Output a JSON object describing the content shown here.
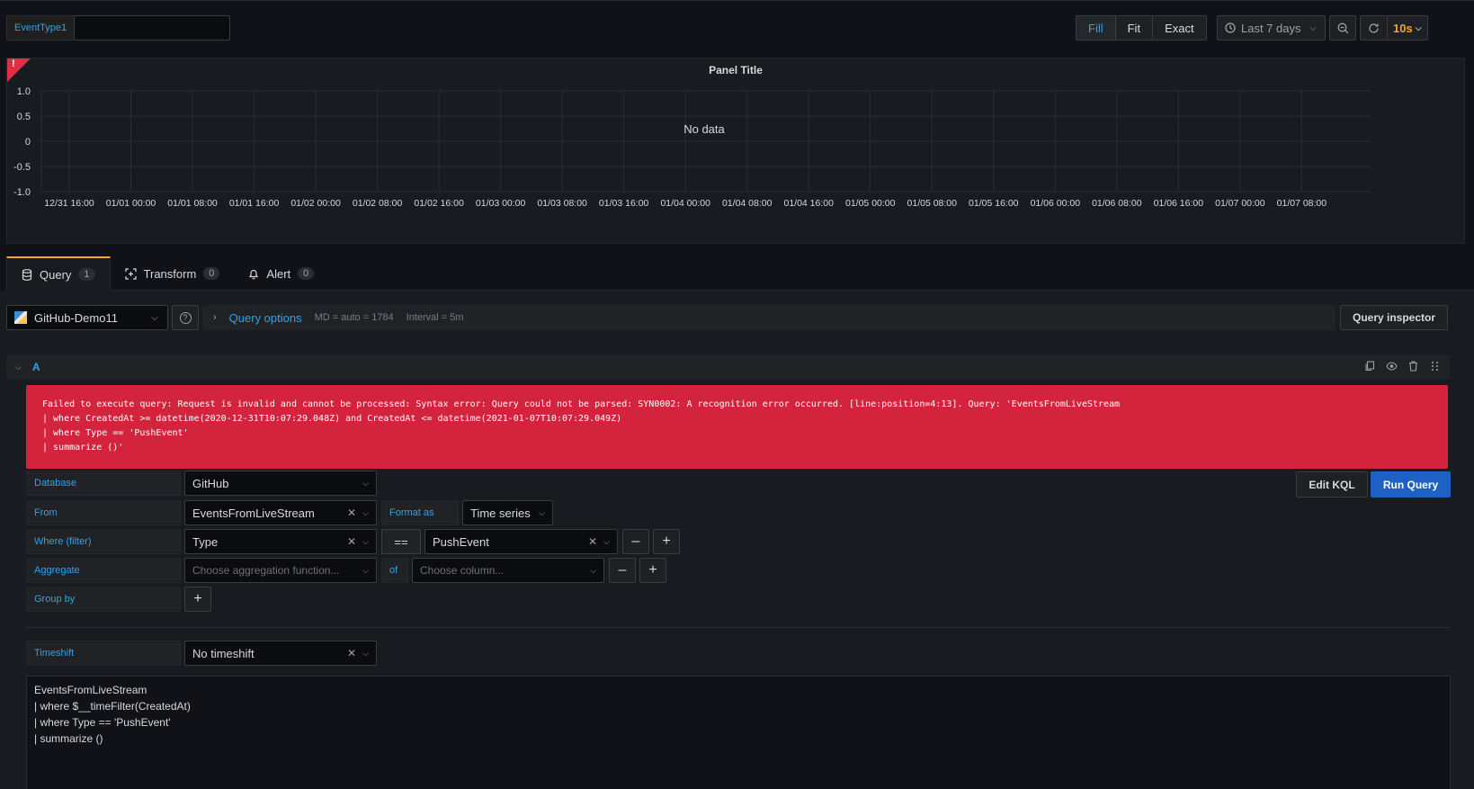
{
  "variable": {
    "label": "EventType1",
    "value": ""
  },
  "toolbar": {
    "fill": "Fill",
    "fit": "Fit",
    "exact": "Exact",
    "time_range": "Last 7 days",
    "refresh_interval": "10s"
  },
  "panel": {
    "title": "Panel Title",
    "no_data": "No data",
    "error_mark": "!"
  },
  "chart_data": {
    "type": "line",
    "title": "Panel Title",
    "y_ticks": [
      "1.0",
      "0.5",
      "0",
      "-0.5",
      "-1.0"
    ],
    "ylim": [
      -1.0,
      1.0
    ],
    "x_ticks": [
      "12/31 16:00",
      "01/01 00:00",
      "01/01 08:00",
      "01/01 16:00",
      "01/02 00:00",
      "01/02 08:00",
      "01/02 16:00",
      "01/03 00:00",
      "01/03 08:00",
      "01/03 16:00",
      "01/04 00:00",
      "01/04 08:00",
      "01/04 16:00",
      "01/05 00:00",
      "01/05 08:00",
      "01/05 16:00",
      "01/06 00:00",
      "01/06 08:00",
      "01/06 16:00",
      "01/07 00:00",
      "01/07 08:00"
    ],
    "series": [],
    "grid": true,
    "annotation": "No data"
  },
  "tabs": [
    {
      "label": "Query",
      "count": "1"
    },
    {
      "label": "Transform",
      "count": "0"
    },
    {
      "label": "Alert",
      "count": "0"
    }
  ],
  "datasource": {
    "name": "GitHub-Demo11"
  },
  "query_options": {
    "label": "Query options",
    "md": "MD = auto = 1784",
    "interval": "Interval = 5m"
  },
  "query_inspector": "Query inspector",
  "query_row": {
    "name": "A"
  },
  "error": {
    "lines": [
      "Failed to execute query: Request is invalid and cannot be processed: Syntax error: Query could not be parsed: SYN0002: A recognition error occurred. [line:position=4:13]. Query: 'EventsFromLiveStream",
      "| where CreatedAt >= datetime(2020-12-31T10:07:29.048Z) and CreatedAt <= datetime(2021-01-07T10:07:29.049Z)",
      "| where Type == 'PushEvent'",
      "| summarize ()'"
    ]
  },
  "builder": {
    "database_label": "Database",
    "database_value": "GitHub",
    "from_label": "From",
    "from_value": "EventsFromLiveStream",
    "format_label": "Format as",
    "format_value": "Time series",
    "where_label": "Where (filter)",
    "where_field": "Type",
    "where_op": "==",
    "where_value": "PushEvent",
    "aggregate_label": "Aggregate",
    "aggregate_placeholder": "Choose aggregation function...",
    "of_label": "of",
    "column_placeholder": "Choose column...",
    "groupby_label": "Group by",
    "timeshift_label": "Timeshift",
    "timeshift_value": "No timeshift",
    "edit_kql": "Edit KQL",
    "run_query": "Run Query"
  },
  "kql": {
    "lines": [
      "EventsFromLiveStream",
      "| where $__timeFilter(CreatedAt)",
      "| where Type == 'PushEvent'",
      "| summarize ()"
    ]
  }
}
